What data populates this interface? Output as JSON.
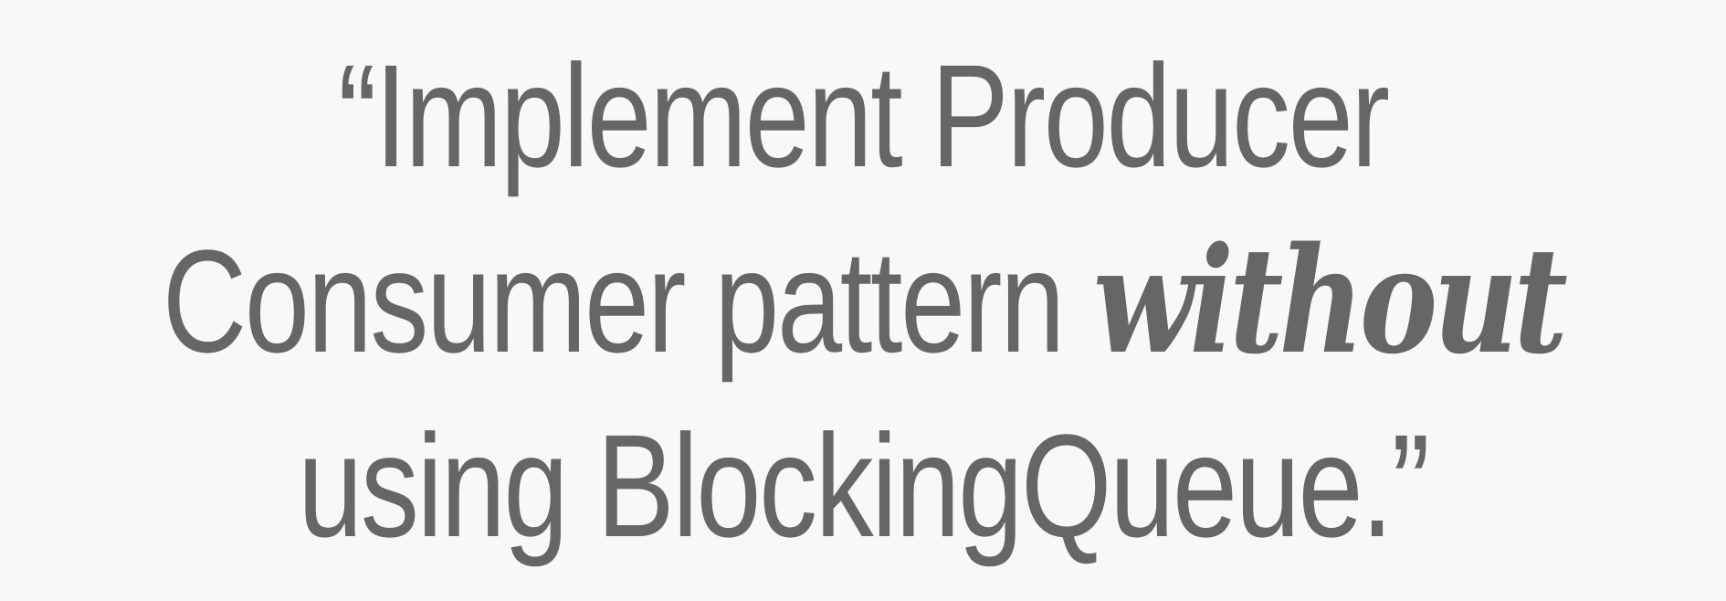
{
  "quote": {
    "line1": "“Implement Producer",
    "line2_before": "Consumer pattern ",
    "line2_emphasis": "without",
    "line3": "using BlockingQueue.”"
  },
  "colors": {
    "background": "#f8f8f8",
    "text": "#666666"
  }
}
